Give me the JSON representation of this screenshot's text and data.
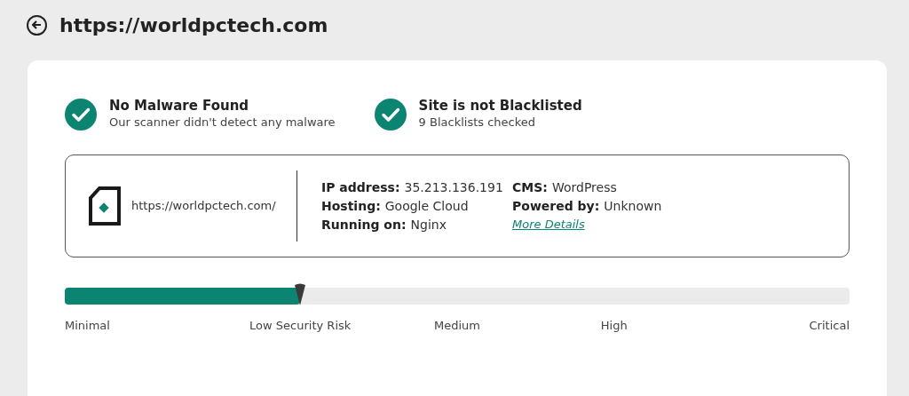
{
  "header": {
    "title": "https://worldpctech.com"
  },
  "checks": [
    {
      "title": "No Malware Found",
      "subtitle": "Our scanner didn't detect any malware",
      "passed": true
    },
    {
      "title": "Site is not Blacklisted",
      "subtitle": "9 Blacklists checked",
      "passed": true
    }
  ],
  "site": {
    "url": "https://worldpctech.com/",
    "info_left": [
      {
        "label": "IP address:",
        "value": "35.213.136.191"
      },
      {
        "label": "Hosting:",
        "value": "Google Cloud"
      },
      {
        "label": "Running on:",
        "value": "Nginx"
      }
    ],
    "info_right": [
      {
        "label": "CMS:",
        "value": "WordPress"
      },
      {
        "label": "Powered by:",
        "value": "Unknown"
      }
    ],
    "more_link": "More Details"
  },
  "risk": {
    "level": 0.3,
    "labels": [
      "Minimal",
      "Low Security Risk",
      "Medium",
      "High",
      "Critical"
    ]
  }
}
